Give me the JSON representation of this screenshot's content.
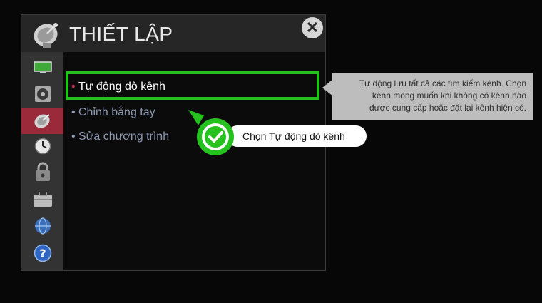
{
  "window": {
    "title": "THIẾT LẬP",
    "header_icon": "satellite-dish-icon",
    "close_label": "✕"
  },
  "sidebar": {
    "items": [
      {
        "name": "picture",
        "icon": "tv-screen-icon"
      },
      {
        "name": "audio",
        "icon": "speaker-icon"
      },
      {
        "name": "setup",
        "icon": "satellite-dish-icon",
        "active": true
      },
      {
        "name": "time",
        "icon": "clock-icon"
      },
      {
        "name": "lock",
        "icon": "lock-icon"
      },
      {
        "name": "option",
        "icon": "toolbox-icon"
      },
      {
        "name": "network",
        "icon": "globe-icon"
      },
      {
        "name": "support",
        "icon": "help-icon"
      }
    ]
  },
  "menu": {
    "items": [
      {
        "label": "Tự động dò kênh",
        "selected": true
      },
      {
        "label": "Chỉnh bằng tay"
      },
      {
        "label": "Sửa chương trình"
      }
    ]
  },
  "tooltip": {
    "text_line1": "Tự động lưu tất cả các tìm kiếm kênh. Chọn",
    "text_line2": "kênh mong muốn khi không có kênh nào",
    "text_line3": "được cung cấp hoặc đặt lại kênh hiện có."
  },
  "callout": {
    "label": "Chọn Tự động dò kênh"
  },
  "colors": {
    "highlight": "#25c21f",
    "active_sidebar": "#9a2a3a",
    "menu_text": "#8e9ab3",
    "tooltip_bg": "#bdbdbd"
  }
}
